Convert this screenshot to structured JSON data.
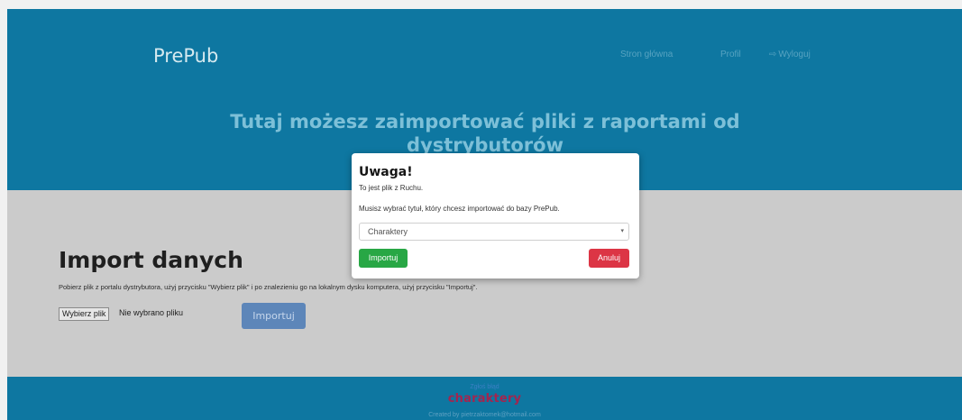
{
  "header": {
    "brand": "PrePub",
    "nav": [
      {
        "label": "Stron główna",
        "icon": ""
      },
      {
        "label": "Profil",
        "icon": ""
      },
      {
        "label": "Wyloguj",
        "icon": "logout-icon"
      }
    ],
    "logout_icon_glyph": "⇨",
    "title": "Tutaj możesz zaimportować pliki z raportami od dystrybutorów"
  },
  "main": {
    "title": "Import danych",
    "description": "Pobierz plik z portalu dystrybutora, użyj przycisku \"Wybierz plik\" i po znalezieniu go na lokalnym dysku komputera, użyj przycisku \"Importuj\".",
    "file_button": "Wybierz plik",
    "file_status": "Nie wybrano pliku",
    "import_button": "Importuj"
  },
  "modal": {
    "title": "Uwaga!",
    "line1": "To jest plik z Ruchu.",
    "line2": "Musisz wybrać tytuł, który chcesz importować do bazy PrePub.",
    "select_value": "Charaktery",
    "caret": "▾",
    "confirm_button": "Importuj",
    "cancel_button": "Anuluj"
  },
  "footer": {
    "report_link": "Zgłoś błąd",
    "logo_text": "charaktery",
    "created": "Created by pietrzaktomek@hotmail.com"
  },
  "colors": {
    "header_bg": "#0e77a1",
    "confirm": "#28a745",
    "cancel": "#dc3545",
    "logo": "#a3254f"
  }
}
